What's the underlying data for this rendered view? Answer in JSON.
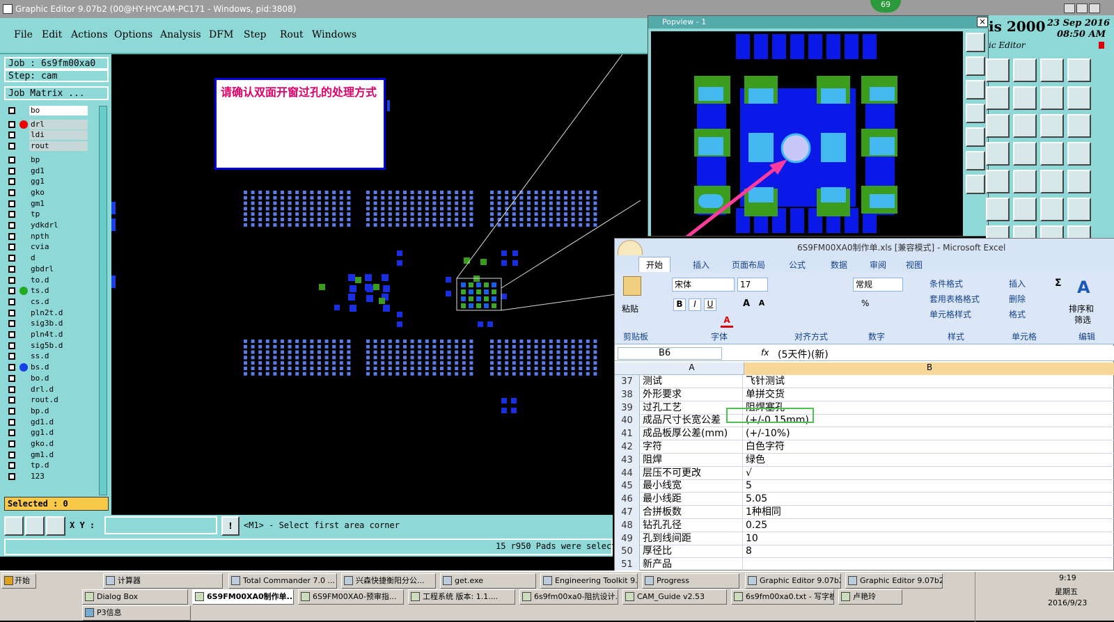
{
  "window": {
    "title": "Graphic Editor 9.07b2 (00@HY-HYCAM-PC171 - Windows, pid:3808)",
    "badge": "69"
  },
  "menu": [
    "File",
    "Edit",
    "Actions",
    "Options",
    "Analysis",
    "DFM",
    "Step",
    "Rout",
    "Windows"
  ],
  "job": {
    "job_label": "Job : 6s9fm00xa0",
    "step_label": "Step: cam",
    "matrix_label": "Job Matrix ...",
    "selected": "Selected : 0"
  },
  "layers": [
    "bo",
    "drl",
    "ldi",
    "rout",
    "bp",
    "gd1",
    "gg1",
    "gko",
    "gm1",
    "tp",
    "ydkdrl",
    "npth",
    "cvia",
    "d",
    "gbdrl",
    "to.d",
    "ts.d",
    "cs.d",
    "pln2t.d",
    "sig3b.d",
    "pln4t.d",
    "sig5b.d",
    "ss.d",
    "bs.d",
    "bo.d",
    "drl.d",
    "rout.d",
    "bp.d",
    "gd1.d",
    "gg1.d",
    "gko.d",
    "gm1.d",
    "tp.d",
    "123"
  ],
  "message": "请确认双面开窗过孔的处理方式",
  "status": {
    "xy_label": "X Y :",
    "prompt": "<M1> - Select first area corner",
    "info": "15 r950 Pads were select"
  },
  "popview": {
    "title": "Popview - 1"
  },
  "right_header": {
    "app": "is 2000",
    "date": "23 Sep 2016",
    "time": "08:50 AM",
    "sub": "ic Editor"
  },
  "excel": {
    "title": "6S9FM00XA0制作单.xls  [兼容模式] - Microsoft Excel",
    "tabs": [
      "开始",
      "插入",
      "页面布局",
      "公式",
      "数据",
      "审阅",
      "视图"
    ],
    "font_name": "宋体",
    "font_size": "17",
    "number_format": "常规",
    "groups": [
      "剪贴板",
      "字体",
      "对齐方式",
      "数字",
      "样式",
      "单元格",
      "编辑"
    ],
    "buttons": {
      "paste": "粘贴",
      "cond_format": "条件格式",
      "table_format": "套用表格格式",
      "cell_style": "单元格样式",
      "insert": "插入",
      "delete": "删除",
      "format": "格式",
      "sort": "排序和",
      "filter": "筛选"
    },
    "cell_ref": "B6",
    "fx": "fx",
    "formula": "(5天件)(新)",
    "columns": [
      "A",
      "B"
    ],
    "rows": [
      {
        "n": "37",
        "a": "测试",
        "b": "飞针测试"
      },
      {
        "n": "38",
        "a": "外形要求",
        "b": "单拼交货"
      },
      {
        "n": "39",
        "a": "过孔工艺",
        "b": "阻焊塞孔"
      },
      {
        "n": "40",
        "a": "成品尺寸长宽公差",
        "b": "(+/-0.15mm)"
      },
      {
        "n": "41",
        "a": "成品板厚公差(mm)",
        "b": "(+/-10%)"
      },
      {
        "n": "42",
        "a": "字符",
        "b": "白色字符"
      },
      {
        "n": "43",
        "a": "阻焊",
        "b": "绿色"
      },
      {
        "n": "44",
        "a": "层压不可更改",
        "b": "√"
      },
      {
        "n": "45",
        "a": "最小线宽",
        "b": "5"
      },
      {
        "n": "46",
        "a": "最小线距",
        "b": "5.05"
      },
      {
        "n": "47",
        "a": "合拼板数",
        "b": "1种相同"
      },
      {
        "n": "48",
        "a": "钻孔孔径",
        "b": "0.25"
      },
      {
        "n": "49",
        "a": "孔到线间距",
        "b": "10"
      },
      {
        "n": "50",
        "a": "厚径比",
        "b": "8"
      },
      {
        "n": "51",
        "a": "新产品",
        "b": ""
      }
    ]
  },
  "taskbar": {
    "start": "开始",
    "row1": [
      "计算器",
      "Total Commander 7.0 ...",
      "兴森快捷衡阳分公...",
      "get.exe",
      "Engineering Toolkit 9....",
      "Progress",
      "Graphic Editor 9.07b2...",
      "Graphic Editor 9.07b2..."
    ],
    "row2": [
      "Dialog Box",
      "6S9FM00XA0制作单....",
      "6S9FM00XA0-预审指...",
      "工程系统  版本: 1.1....",
      "6s9fm00xa0-阻抗设计...",
      "CAM_Guide v2.53",
      "6s9fm00xa0.txt - 写字板",
      "卢艳玲"
    ],
    "row3": [
      "P3信息"
    ],
    "clock": "9:19",
    "weekday": "星期五",
    "date": "2016/9/23"
  }
}
